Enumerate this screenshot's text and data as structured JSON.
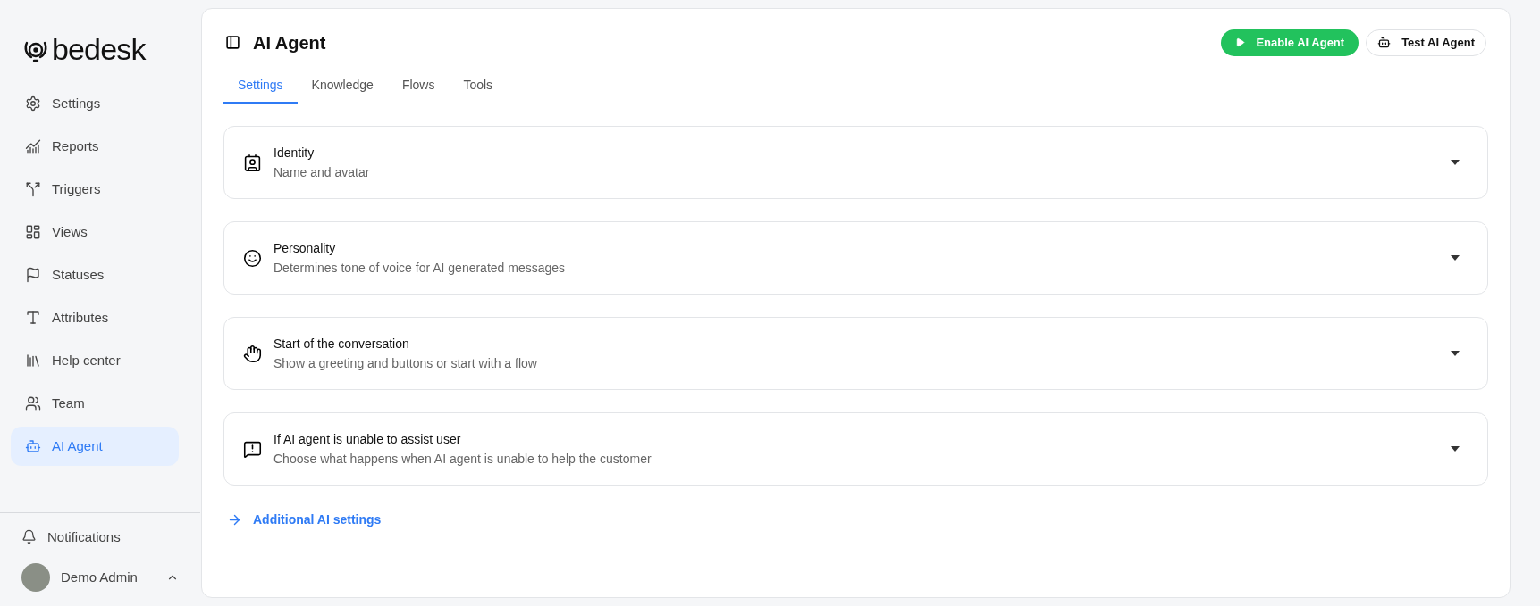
{
  "sidebar": {
    "logo": "bedesk",
    "items": [
      {
        "label": "Settings",
        "kind": "settings",
        "selected": false
      },
      {
        "label": "Reports",
        "kind": "reports",
        "selected": false
      },
      {
        "label": "Triggers",
        "kind": "triggers",
        "selected": false
      },
      {
        "label": "Views",
        "kind": "views",
        "selected": false
      },
      {
        "label": "Statuses",
        "kind": "statuses",
        "selected": false
      },
      {
        "label": "Attributes",
        "kind": "attributes",
        "selected": false
      },
      {
        "label": "Help center",
        "kind": "help",
        "selected": false
      },
      {
        "label": "Team",
        "kind": "team",
        "selected": false
      },
      {
        "label": "AI Agent",
        "kind": "agent",
        "selected": true
      }
    ],
    "notifications": "Notifications",
    "user": "Demo Admin"
  },
  "header": {
    "title": "AI Agent",
    "buttons": [
      {
        "label": "Enable AI Agent",
        "kind": "primary"
      },
      {
        "label": "Test AI Agent",
        "kind": "secondary"
      }
    ]
  },
  "tabs": [
    {
      "label": "Settings",
      "selected": true
    },
    {
      "label": "Knowledge",
      "selected": false
    },
    {
      "label": "Flows",
      "selected": false
    },
    {
      "label": "Tools",
      "selected": false
    }
  ],
  "sections": [
    {
      "title": "Identity",
      "subtitle": "Name and avatar",
      "kind": "identity"
    },
    {
      "title": "Personality",
      "subtitle": "Determines tone of voice for AI generated messages",
      "kind": "personality"
    },
    {
      "title": "Start of the conversation",
      "subtitle": "Show a greeting and buttons or start with a flow",
      "kind": "start"
    },
    {
      "title": "If AI agent is unable to assist user",
      "subtitle": "Choose what happens when AI agent is unable to help the customer",
      "kind": "fallback"
    }
  ],
  "link": "Additional AI settings"
}
